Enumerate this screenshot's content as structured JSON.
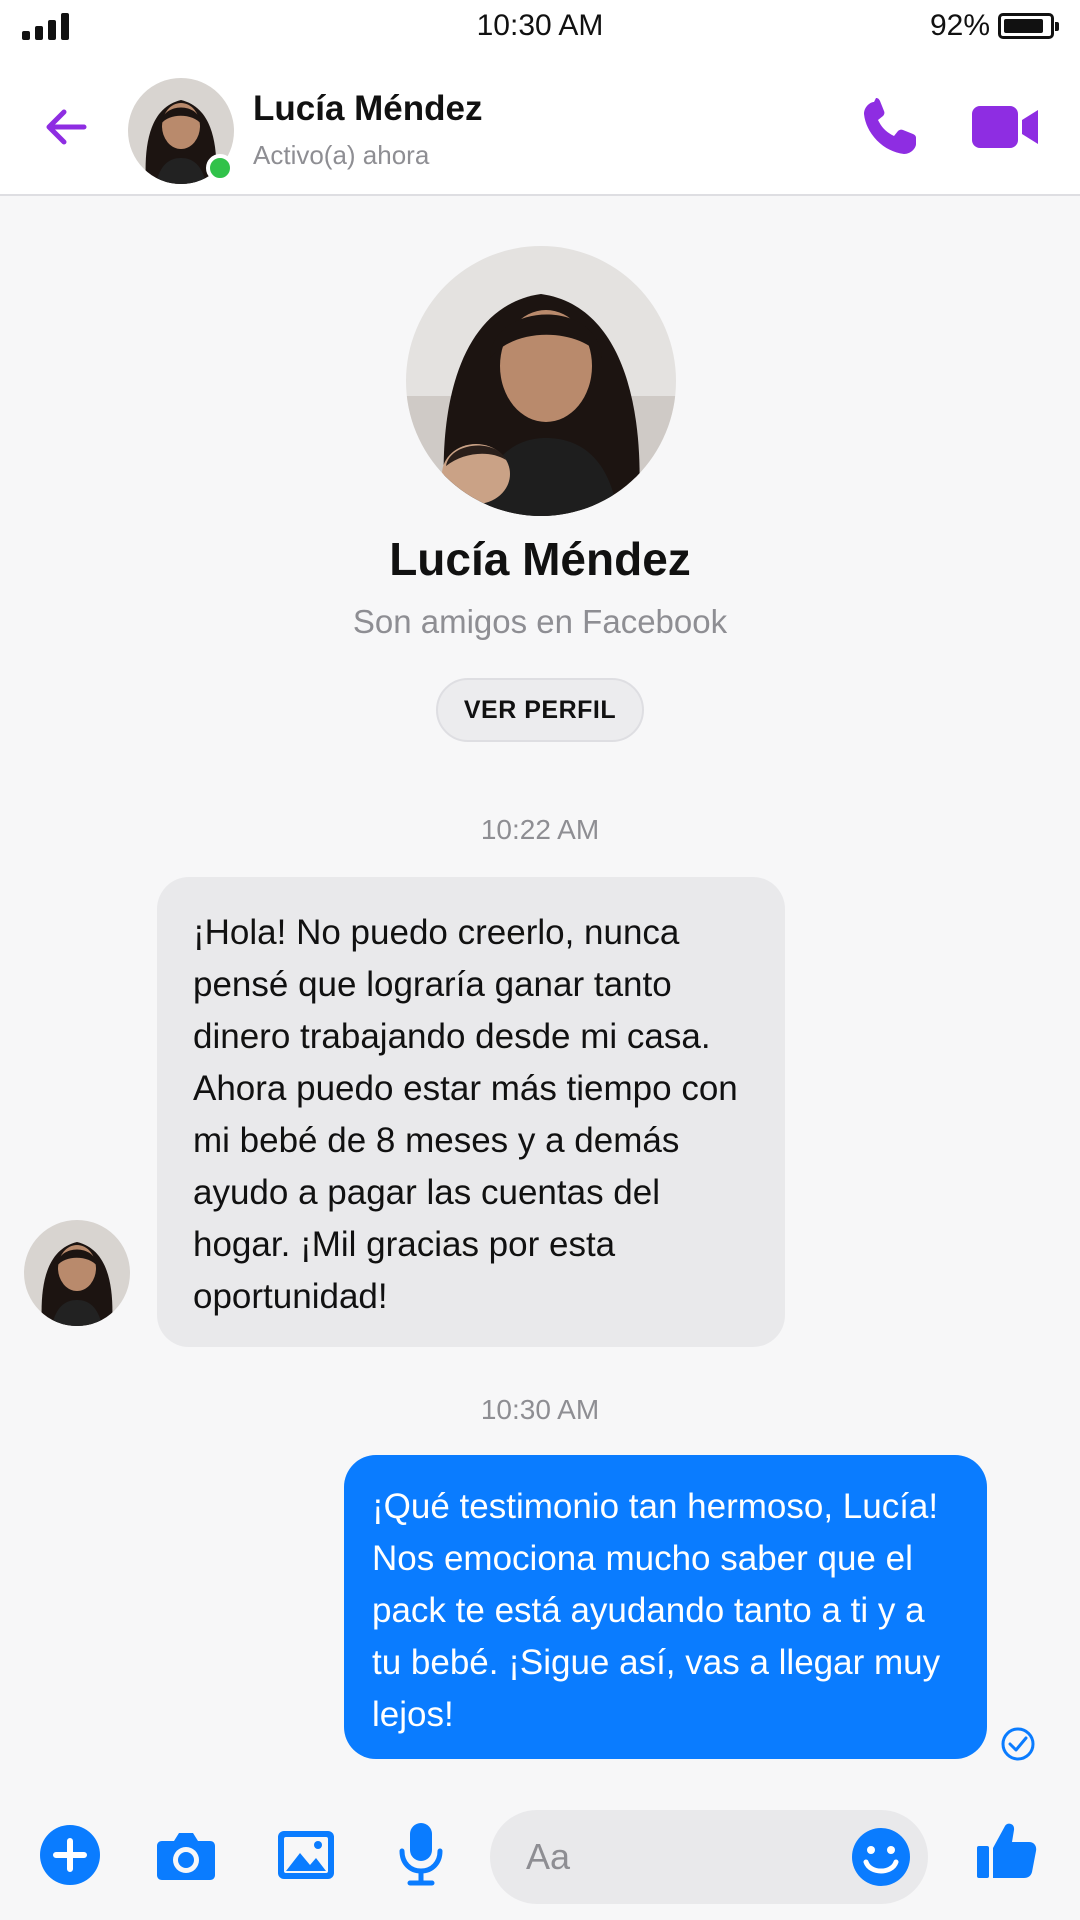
{
  "status_bar": {
    "time": "10:30 AM",
    "battery_percent": "92%",
    "battery_level": 0.92,
    "signal_bars": 4
  },
  "header": {
    "back_icon": "arrow-left-icon",
    "contact_name": "Lucía Méndez",
    "contact_status": "Activo(a) ahora",
    "online": true,
    "call_icon": "phone-icon",
    "video_icon": "video-camera-icon"
  },
  "profile": {
    "name": "Lucía Méndez",
    "subtitle": "Son amigos en Facebook",
    "view_profile_label": "VER PERFIL"
  },
  "conversation": {
    "timestamps": [
      "10:22 AM",
      "10:30 AM"
    ],
    "messages": [
      {
        "direction": "incoming",
        "text": "¡Hola! No puedo creerlo, nunca pensé que lograría ganar tanto dinero trabajando desde mi casa. Ahora puedo estar más tiempo con mi bebé de 8 meses y a demás ayudo a pagar las cuentas del hogar. ¡Mil gracias por esta oportunidad!"
      },
      {
        "direction": "outgoing",
        "text": "¡Qué testimonio tan hermoso, Lucía! Nos emociona mucho saber que el pack te está ayudando tanto a ti y a tu bebé. ¡Sigue así, vas a llegar muy lejos!",
        "status": "sent"
      }
    ]
  },
  "composer": {
    "placeholder": "Aa",
    "tools": [
      "plus-icon",
      "camera-icon",
      "image-icon",
      "microphone-icon"
    ],
    "emoji_icon": "smiley-icon",
    "like_icon": "thumbs-up-icon"
  },
  "colors": {
    "accent_purple": "#8e2de2",
    "messenger_blue": "#0a7cff",
    "incoming_bubble": "#e9e9eb",
    "online_green": "#31c24a"
  }
}
